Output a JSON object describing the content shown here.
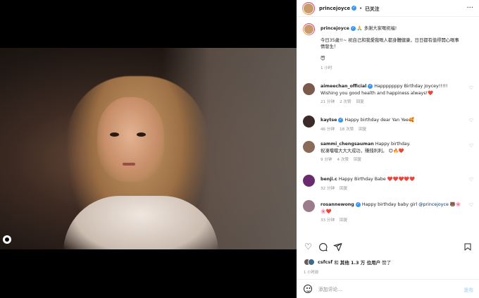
{
  "post": {
    "author": "princejoyce",
    "follow_status": "已关注",
    "dot": "•",
    "more": "···",
    "caption_title": "🙏 多謝大家嘅祝福!",
    "caption_body": "今日35歲!!~ 祝自己和我愛我嘅人都身體健康，日日都有值得開心嘅事情發生！",
    "caption_emoji": "😇",
    "caption_time": "1 小时"
  },
  "comments": [
    {
      "user": "aimeechan_official",
      "verified": true,
      "text": "Happpppppy Birthday Joycey!!!!! Wishing you good health and happiness always!",
      "heart": "❤️",
      "time": "21 分钟",
      "likes": "2 次赞",
      "reply": "回复",
      "avatar_color": "#7a5a4a"
    },
    {
      "user": "kaytse",
      "verified": true,
      "text": "Happy birthday dear Yan Yee",
      "emoji": "🥰",
      "time": "46 分钟",
      "likes": "18 次赞",
      "reply": "回复",
      "avatar_color": "#3b2a2a"
    },
    {
      "user": "sammi_chengsauman",
      "verified": false,
      "text": "Happy birthday.",
      "text2": "祝凍噹噹大大大成功，賺錢利利。",
      "emoji": "😊🔥❤️",
      "time": "9 分钟",
      "likes": "4 次赞",
      "reply": "回复",
      "avatar_color": "#8a6a58"
    },
    {
      "user": "benji.c",
      "verified": false,
      "text": "Happy Birthday Babe",
      "hearts": "❤️❤️❤️❤️❤️",
      "time": "32 分钟",
      "reply": "回复",
      "avatar_color": "#6b2a70"
    },
    {
      "user": "rosannewong",
      "verified": true,
      "text": "Happy birthday baby girl ",
      "mention": "@princejoyce",
      "emoji": "🐻🌸🌸❤️",
      "time": "33 分钟",
      "reply": "回复",
      "avatar_color": "#9c7b8a"
    }
  ],
  "actions": {
    "like_icon": "heart-icon",
    "comment_icon": "comment-icon",
    "share_icon": "share-icon",
    "save_icon": "bookmark-icon"
  },
  "likes": {
    "prefix": "csfcsf",
    "and": "和",
    "others": "其他 1.3 万 位用户",
    "suffix": "赞了"
  },
  "post_time": "1 小时前",
  "composer": {
    "placeholder": "添加评论...",
    "post_label": "发布"
  }
}
